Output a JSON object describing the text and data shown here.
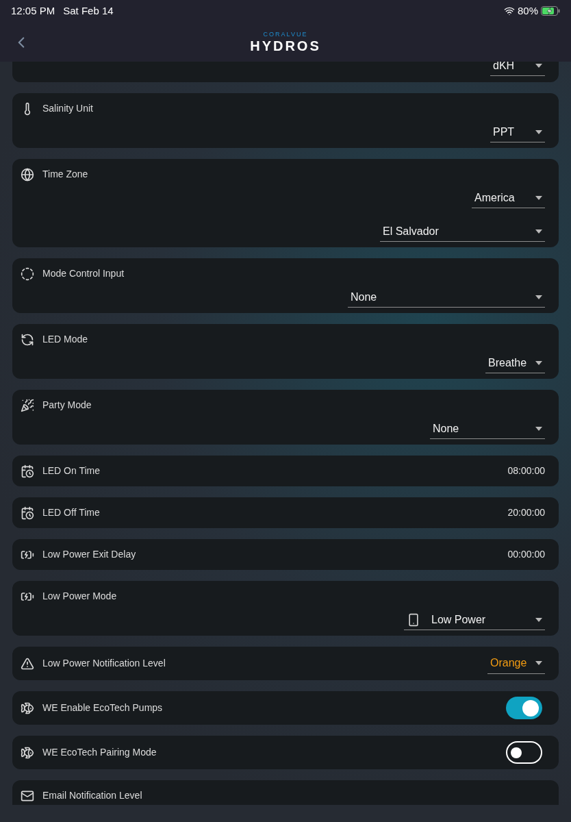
{
  "status_bar": {
    "time": "12:05 PM",
    "date": "Sat Feb 14",
    "battery": "80%"
  },
  "header": {
    "brand_top": "CORALVUE",
    "brand_main": "HYDROS"
  },
  "rows": [
    {
      "kind": "dropdown",
      "selects": [
        {
          "value": "dKH"
        }
      ]
    },
    {
      "kind": "dropdown",
      "label": "Salinity Unit",
      "selects": [
        {
          "value": "PPT"
        }
      ]
    },
    {
      "kind": "dropdown",
      "label": "Time Zone",
      "selects": [
        {
          "value": "America"
        },
        {
          "value": "El Salvador"
        }
      ]
    },
    {
      "kind": "dropdown",
      "label": "Mode Control Input",
      "selects": [
        {
          "value": "None"
        }
      ]
    },
    {
      "kind": "dropdown",
      "label": "LED Mode",
      "selects": [
        {
          "value": "Breathe"
        }
      ]
    },
    {
      "kind": "dropdown",
      "label": "Party Mode",
      "selects": [
        {
          "value": "None"
        }
      ]
    },
    {
      "kind": "time",
      "label": "LED On Time",
      "value": "08:00:00"
    },
    {
      "kind": "time",
      "label": "LED Off Time",
      "value": "20:00:00"
    },
    {
      "kind": "time",
      "label": "Low Power Exit Delay",
      "value": "00:00:00"
    },
    {
      "kind": "dropdown",
      "label": "Low Power Mode",
      "selects": [
        {
          "value": "Low Power"
        }
      ]
    },
    {
      "kind": "inline",
      "label": "Low Power Notification Level",
      "selects": [
        {
          "value": "Orange",
          "color": "#f39c12"
        }
      ]
    },
    {
      "kind": "toggle",
      "label": "WE Enable EcoTech Pumps",
      "on": true
    },
    {
      "kind": "toggle",
      "label": "WE EcoTech Pairing Mode",
      "on": false
    },
    {
      "kind": "partial",
      "label": "Email Notification Level"
    }
  ]
}
